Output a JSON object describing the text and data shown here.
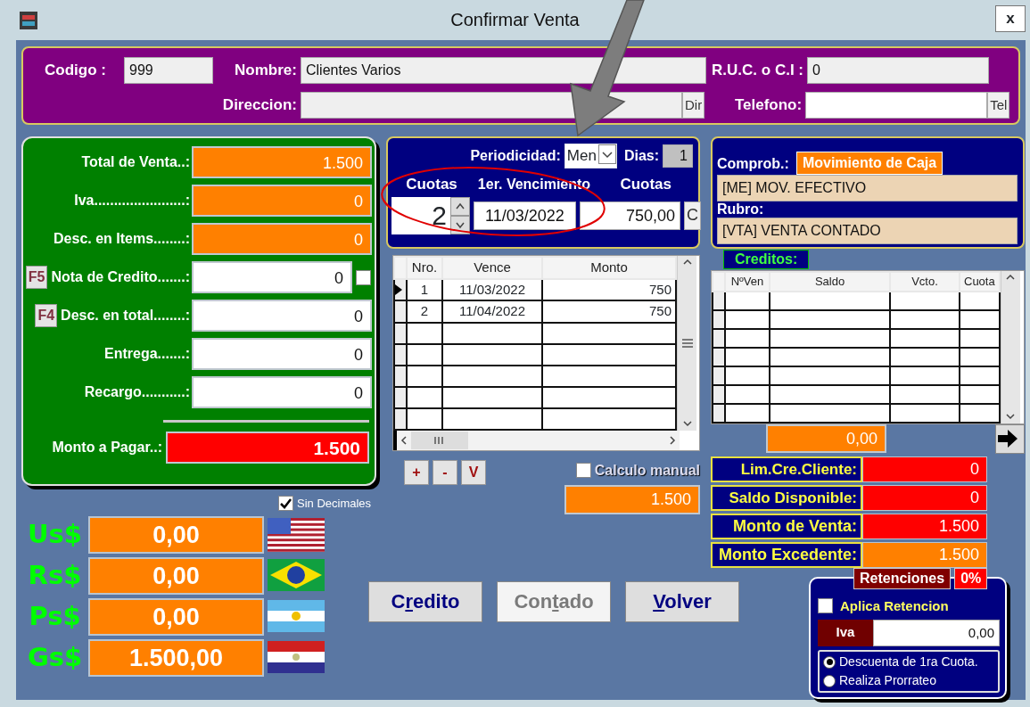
{
  "window": {
    "title": "Confirmar Venta",
    "close": "x"
  },
  "header": {
    "codigo": {
      "label": "Codigo :",
      "value": "999"
    },
    "nombre": {
      "label": "Nombre:",
      "value": "Clientes Varios"
    },
    "ruc": {
      "label": "R.U.C. o C.I :",
      "value": "0"
    },
    "direccion": {
      "label": "Direccion:",
      "button": "Dir"
    },
    "telefono": {
      "label": "Telefono:",
      "button": "Tel"
    }
  },
  "totals": {
    "rows": [
      {
        "label": "Total de Venta..:",
        "value": "1.500",
        "kind": "readonly"
      },
      {
        "label": "Iva.......................:",
        "value": "0",
        "kind": "readonly"
      },
      {
        "label": "Desc. en Items........:",
        "value": "0",
        "kind": "readonly"
      },
      {
        "label": "Nota de Credito.......:",
        "value": "0",
        "kind": "check",
        "key": "F5",
        "checked": false
      },
      {
        "label": "Desc. en total........:",
        "value": "0",
        "kind": "input",
        "key": "F4"
      },
      {
        "label": "Entrega.......:",
        "value": "0",
        "kind": "input"
      },
      {
        "label": "Recargo...........:",
        "value": "0",
        "kind": "input"
      }
    ],
    "monto": {
      "label": "Monto a Pagar..:",
      "value": "1.500"
    }
  },
  "currency": {
    "sin_decimales": {
      "label": "Sin Decimales",
      "checked": true
    },
    "rows": [
      {
        "label": "Us$",
        "value": "0,00",
        "kind": "us"
      },
      {
        "label": "Rs$",
        "value": "0,00",
        "kind": "br"
      },
      {
        "label": "Ps$",
        "value": "0,00",
        "kind": "ar"
      },
      {
        "label": "Gs$",
        "value": "1.500,00",
        "kind": "py"
      }
    ]
  },
  "plan": {
    "periodicidad_label": "Periodicidad:",
    "periodicidad": "Men",
    "dias_label": "Dias:",
    "dias": "1",
    "headers": [
      "Cuotas",
      "1er. Vencimiento",
      "Cuotas"
    ],
    "cuotas": "2",
    "vencimiento": "11/03/2022",
    "monto": "750,00",
    "calc_button": "C"
  },
  "schedule": {
    "columns": [
      "Nro.",
      "Vence",
      "Monto"
    ],
    "rows": [
      {
        "cells": [
          "1",
          "11/03/2022",
          "750"
        ],
        "selected": true
      },
      {
        "cells": [
          "2",
          "11/04/2022",
          "750"
        ],
        "selected": false
      }
    ]
  },
  "row_buttons": [
    "+",
    "-",
    "V"
  ],
  "calculo_manual": {
    "label": "Calculo manual",
    "checked": false,
    "value": "1.500"
  },
  "caja": {
    "badge": "Movimiento de Caja",
    "comprob_label": "Comprob.:",
    "comprob": "[ME] MOV. EFECTIVO",
    "rubro_label": "Rubro:",
    "rubro": "[VTA] VENTA CONTADO"
  },
  "creditos": {
    "title": "Creditos:",
    "columns": [
      "NºVen",
      "Saldo",
      "Vcto.",
      "Cuota"
    ],
    "total": "0,00"
  },
  "summary": [
    {
      "label": "Lim.Cre.Cliente:",
      "value": "0",
      "color": "#ff0000"
    },
    {
      "label": "Saldo Disponible:",
      "value": "0",
      "color": "#ff0000"
    },
    {
      "label": "Monto de Venta:",
      "value": "1.500",
      "color": "#ff0000"
    },
    {
      "label": "Monto Excedente:",
      "value": "1.500",
      "color": "#ff8000"
    }
  ],
  "actions": [
    {
      "before": "C",
      "access_key": "r",
      "after": "edito",
      "disabled": false
    },
    {
      "before": "Con",
      "access_key": "t",
      "after": "ado",
      "disabled": true
    },
    {
      "access_key": "V",
      "after": "olver",
      "disabled": false
    }
  ],
  "retenciones": {
    "title": "Retenciones",
    "percent": "0%",
    "aplica": {
      "label": "Aplica Retencion",
      "checked": false
    },
    "iva_label": "Iva",
    "iva": "0,00",
    "options": [
      {
        "label": "Descuenta de 1ra Cuota.",
        "selected": true
      },
      {
        "label": "Realiza Prorrateo",
        "selected": false
      }
    ]
  }
}
